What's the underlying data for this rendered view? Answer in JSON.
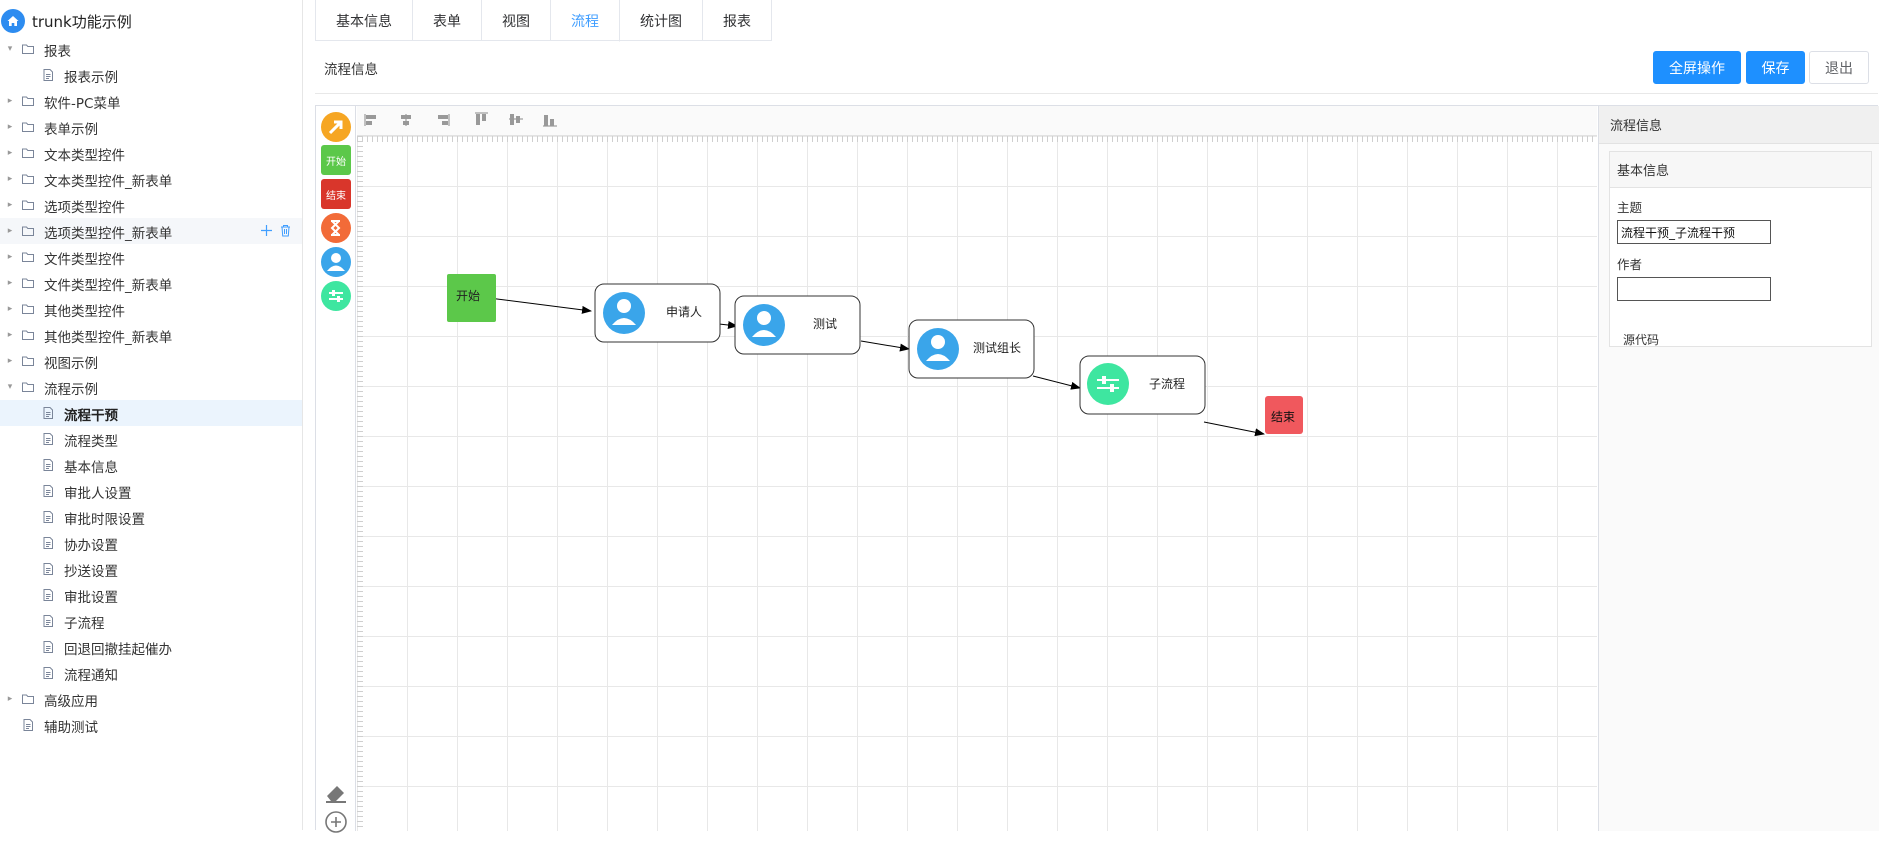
{
  "sidebar": {
    "root_label": "trunk功能示例",
    "items": [
      {
        "label": "报表",
        "type": "folder",
        "expanded": true
      },
      {
        "label": "报表示例",
        "type": "doc"
      },
      {
        "label": "软件-PC菜单",
        "type": "folder"
      },
      {
        "label": "表单示例",
        "type": "folder"
      },
      {
        "label": "文本类型控件",
        "type": "folder"
      },
      {
        "label": "文本类型控件_新表单",
        "type": "folder"
      },
      {
        "label": "选项类型控件",
        "type": "folder"
      },
      {
        "label": "选项类型控件_新表单",
        "type": "folder"
      },
      {
        "label": "文件类型控件",
        "type": "folder"
      },
      {
        "label": "文件类型控件_新表单",
        "type": "folder"
      },
      {
        "label": "其他类型控件",
        "type": "folder"
      },
      {
        "label": "其他类型控件_新表单",
        "type": "folder"
      },
      {
        "label": "视图示例",
        "type": "folder"
      },
      {
        "label": "流程示例",
        "type": "folder",
        "expanded": true
      },
      {
        "label": "流程干预",
        "type": "doc",
        "selected": true
      },
      {
        "label": "流程类型",
        "type": "doc"
      },
      {
        "label": "基本信息",
        "type": "doc"
      },
      {
        "label": "审批人设置",
        "type": "doc"
      },
      {
        "label": "审批时限设置",
        "type": "doc"
      },
      {
        "label": "协办设置",
        "type": "doc"
      },
      {
        "label": "抄送设置",
        "type": "doc"
      },
      {
        "label": "审批设置",
        "type": "doc"
      },
      {
        "label": "子流程",
        "type": "doc"
      },
      {
        "label": "回退回撤挂起催办",
        "type": "doc"
      },
      {
        "label": "流程通知",
        "type": "doc"
      },
      {
        "label": "高级应用",
        "type": "folder"
      },
      {
        "label": "辅助测试",
        "type": "doc"
      }
    ],
    "item_action_icons": [
      "plus-icon",
      "trash-icon"
    ]
  },
  "tabs": [
    {
      "label": "基本信息"
    },
    {
      "label": "表单"
    },
    {
      "label": "视图"
    },
    {
      "label": "流程",
      "active": true
    },
    {
      "label": "统计图"
    },
    {
      "label": "报表"
    }
  ],
  "header": {
    "title": "流程信息",
    "fullscreen_label": "全屏操作",
    "save_label": "保存",
    "exit_label": "退出"
  },
  "palette": {
    "tools": [
      {
        "name": "connector-arrow-icon",
        "color": "#f6a623"
      },
      {
        "name": "start-node",
        "label": "开始",
        "color": "#5cc84a"
      },
      {
        "name": "end-node",
        "label": "结束",
        "color": "#d9362b"
      },
      {
        "name": "timer-node-icon",
        "color": "#f26b38"
      },
      {
        "name": "user-task-icon",
        "color": "#3aa5ea"
      },
      {
        "name": "subprocess-icon",
        "color": "#3ee6a0"
      }
    ],
    "bottom_tools": [
      "eraser-icon",
      "zoom-in-icon"
    ]
  },
  "align_toolbar": [
    "align-left-icon",
    "align-center-icon",
    "align-right-icon",
    "align-top-icon",
    "align-middle-icon",
    "align-bottom-icon"
  ],
  "flow": {
    "nodes": [
      {
        "id": "start",
        "label": "开始",
        "kind": "start"
      },
      {
        "id": "applicant",
        "label": "申请人",
        "kind": "user"
      },
      {
        "id": "test",
        "label": "测试",
        "kind": "user"
      },
      {
        "id": "test-leader",
        "label": "测试组长",
        "kind": "user"
      },
      {
        "id": "subflow",
        "label": "子流程",
        "kind": "subprocess"
      },
      {
        "id": "end",
        "label": "结束",
        "kind": "end"
      }
    ],
    "colors": {
      "start": "#5cc84a",
      "end": "#f0585d",
      "user": "#3aa5ea",
      "subprocess": "#3ee6a0"
    }
  },
  "properties": {
    "panel_title": "流程信息",
    "card_title": "基本信息",
    "subject_label": "主题",
    "subject_value": "流程干预_子流程干预",
    "author_label": "作者",
    "author_value": "",
    "source_code_label": "源代码"
  }
}
